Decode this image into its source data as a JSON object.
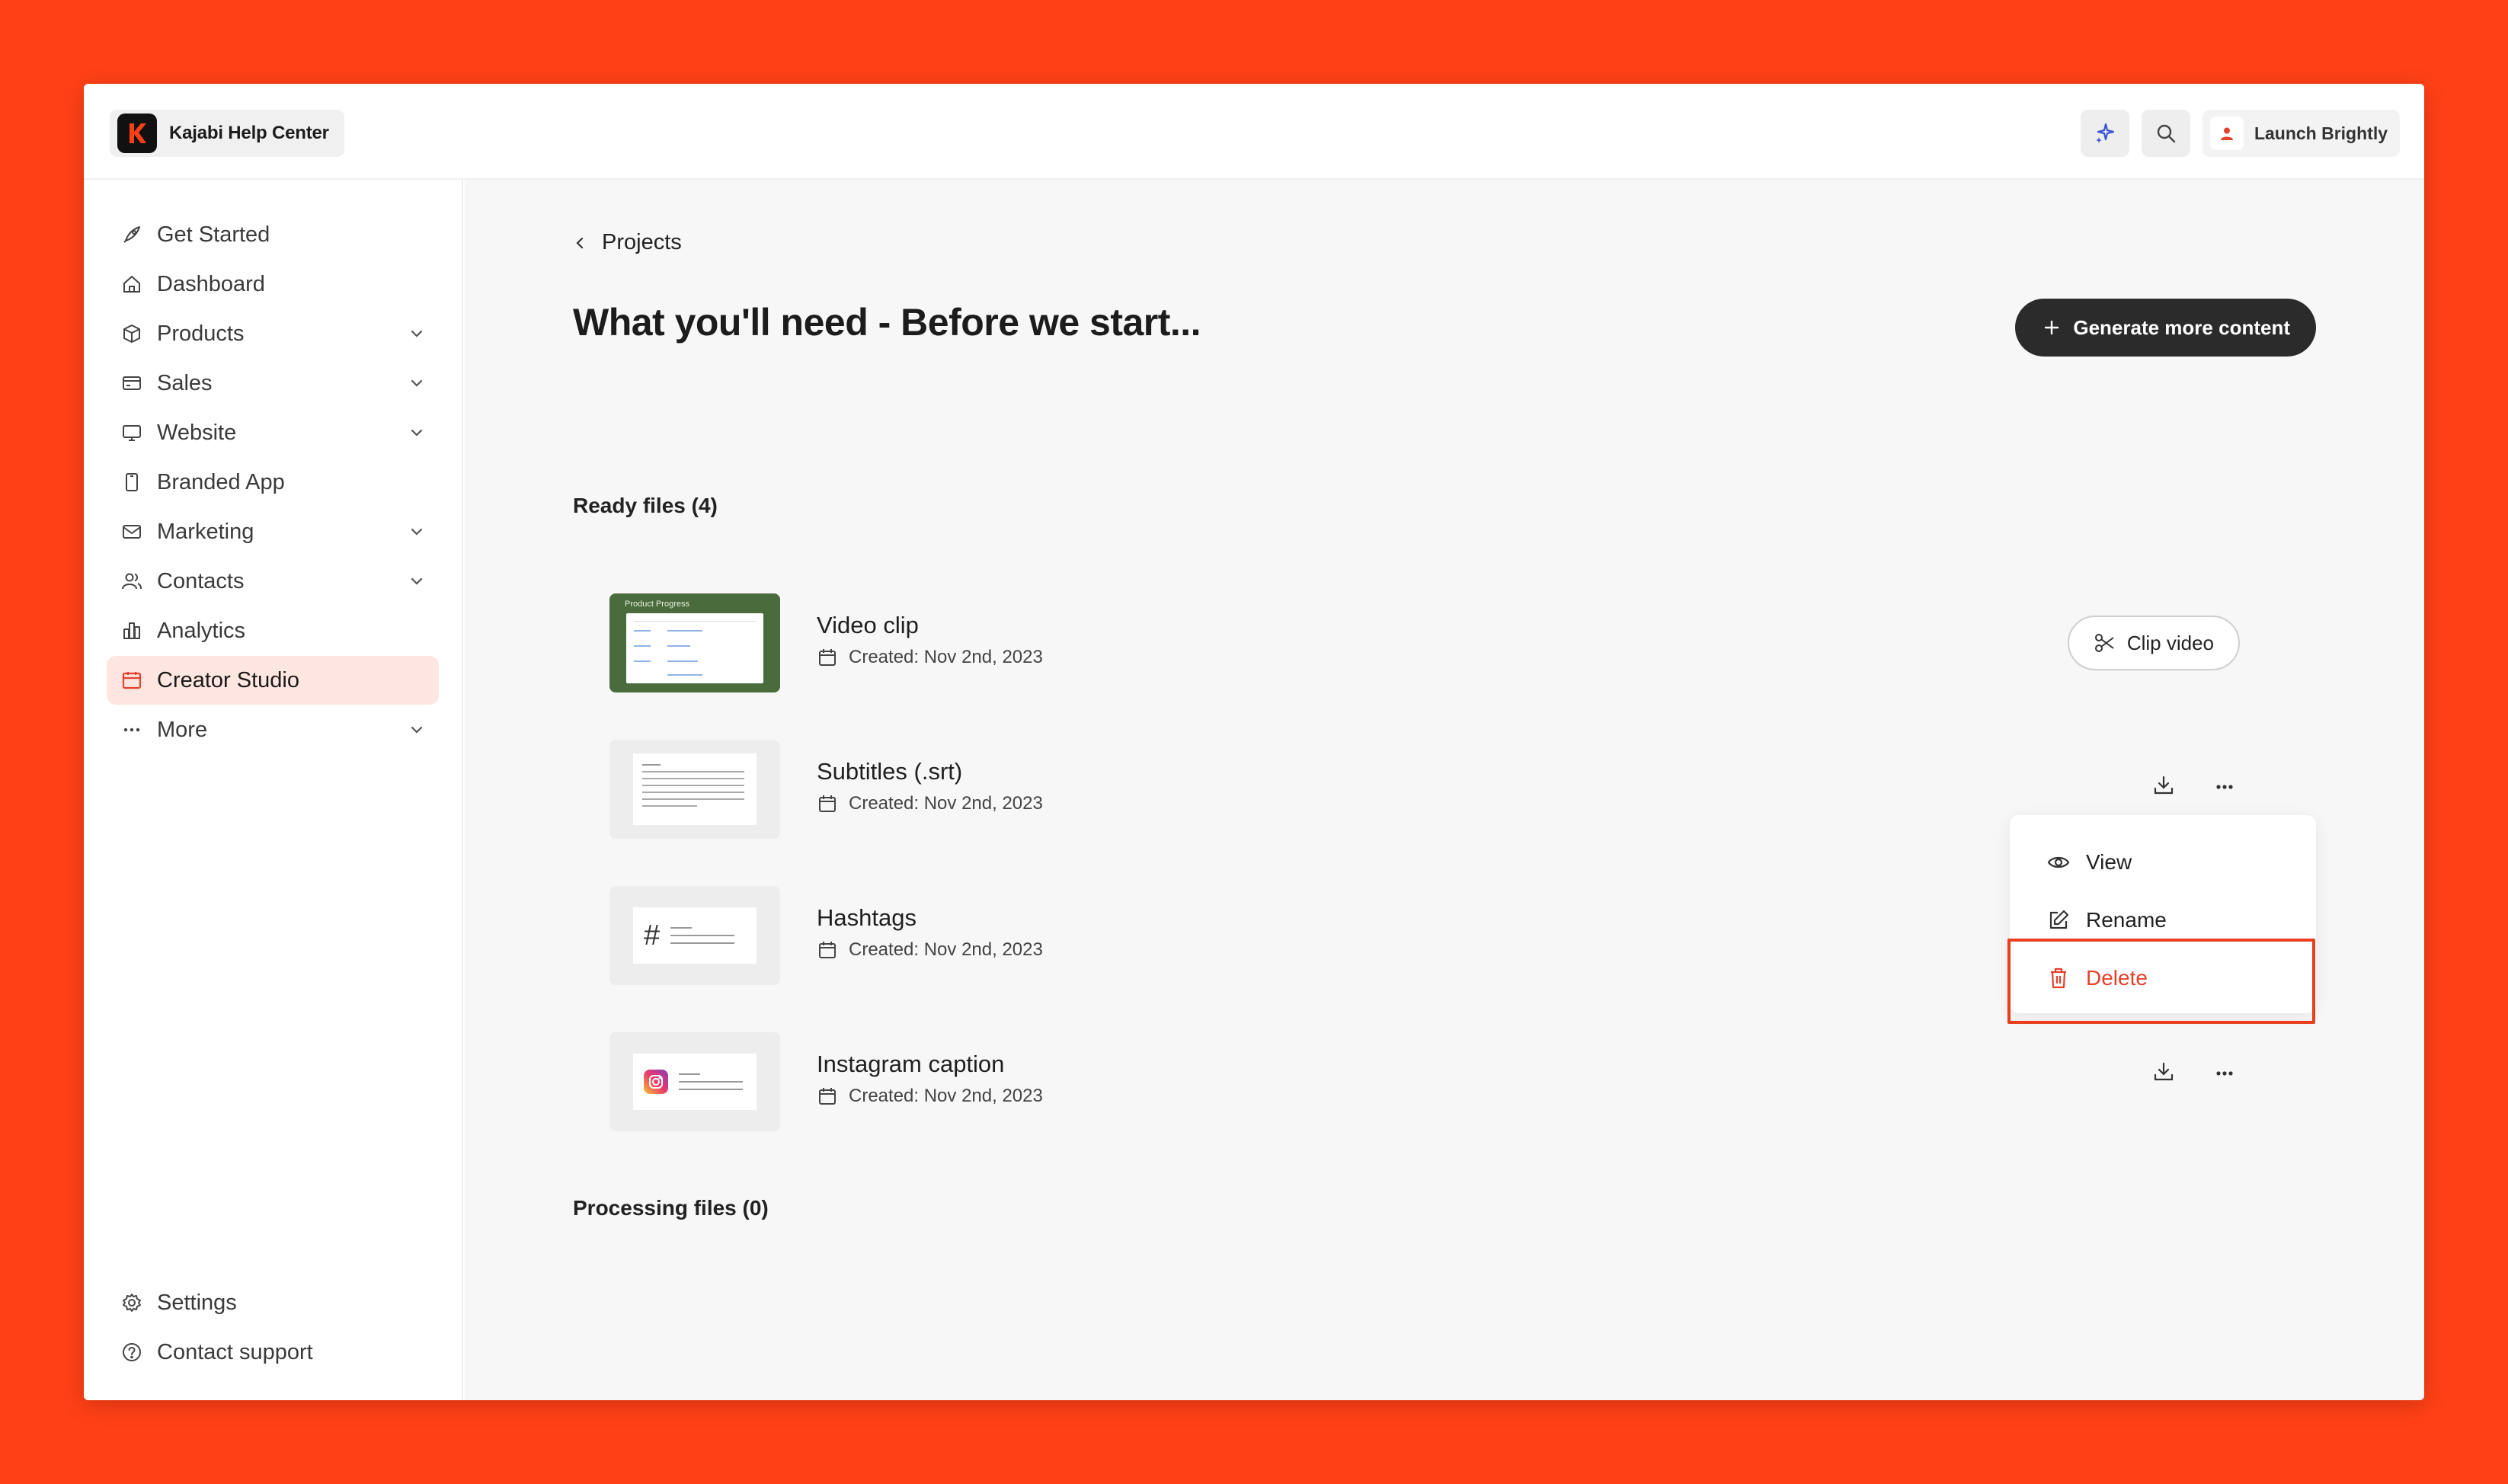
{
  "brand": {
    "name": "Kajabi Help Center"
  },
  "topbar": {
    "user_name": "Launch Brightly"
  },
  "sidebar": {
    "items": [
      {
        "label": "Get Started",
        "icon": "rocket-icon",
        "has_children": false
      },
      {
        "label": "Dashboard",
        "icon": "home-icon",
        "has_children": false
      },
      {
        "label": "Products",
        "icon": "box-icon",
        "has_children": true
      },
      {
        "label": "Sales",
        "icon": "credit-card-icon",
        "has_children": true
      },
      {
        "label": "Website",
        "icon": "monitor-icon",
        "has_children": true
      },
      {
        "label": "Branded App",
        "icon": "phone-icon",
        "has_children": false
      },
      {
        "label": "Marketing",
        "icon": "mail-icon",
        "has_children": true
      },
      {
        "label": "Contacts",
        "icon": "users-icon",
        "has_children": true
      },
      {
        "label": "Analytics",
        "icon": "bar-chart-icon",
        "has_children": false
      },
      {
        "label": "Creator Studio",
        "icon": "calendar-icon",
        "has_children": false,
        "active": true
      },
      {
        "label": "More",
        "icon": "ellipsis-icon",
        "has_children": true
      }
    ],
    "bottom_items": [
      {
        "label": "Settings",
        "icon": "gear-icon"
      },
      {
        "label": "Contact support",
        "icon": "help-circle-icon"
      }
    ]
  },
  "main": {
    "breadcrumb": "Projects",
    "title": "What you'll need - Before we start...",
    "generate_button": "Generate more content",
    "ready_title": "Ready files (4)",
    "processing_title": "Processing files (0)",
    "files": [
      {
        "name": "Video clip",
        "created": "Created: Nov 2nd, 2023",
        "thumb_title": "Product Progress",
        "action": "Clip video"
      },
      {
        "name": "Subtitles (.srt)",
        "created": "Created: Nov 2nd, 2023"
      },
      {
        "name": "Hashtags",
        "created": "Created: Nov 2nd, 2023",
        "thumb_symbol": "#"
      },
      {
        "name": "Instagram caption",
        "created": "Created: Nov 2nd, 2023"
      }
    ],
    "menu": {
      "view": "View",
      "rename": "Rename",
      "delete": "Delete"
    }
  },
  "colors": {
    "background": "#FF4016",
    "active_nav": "#FFE6E0",
    "danger": "#E4412C",
    "primary_button": "#2B2B2B"
  }
}
